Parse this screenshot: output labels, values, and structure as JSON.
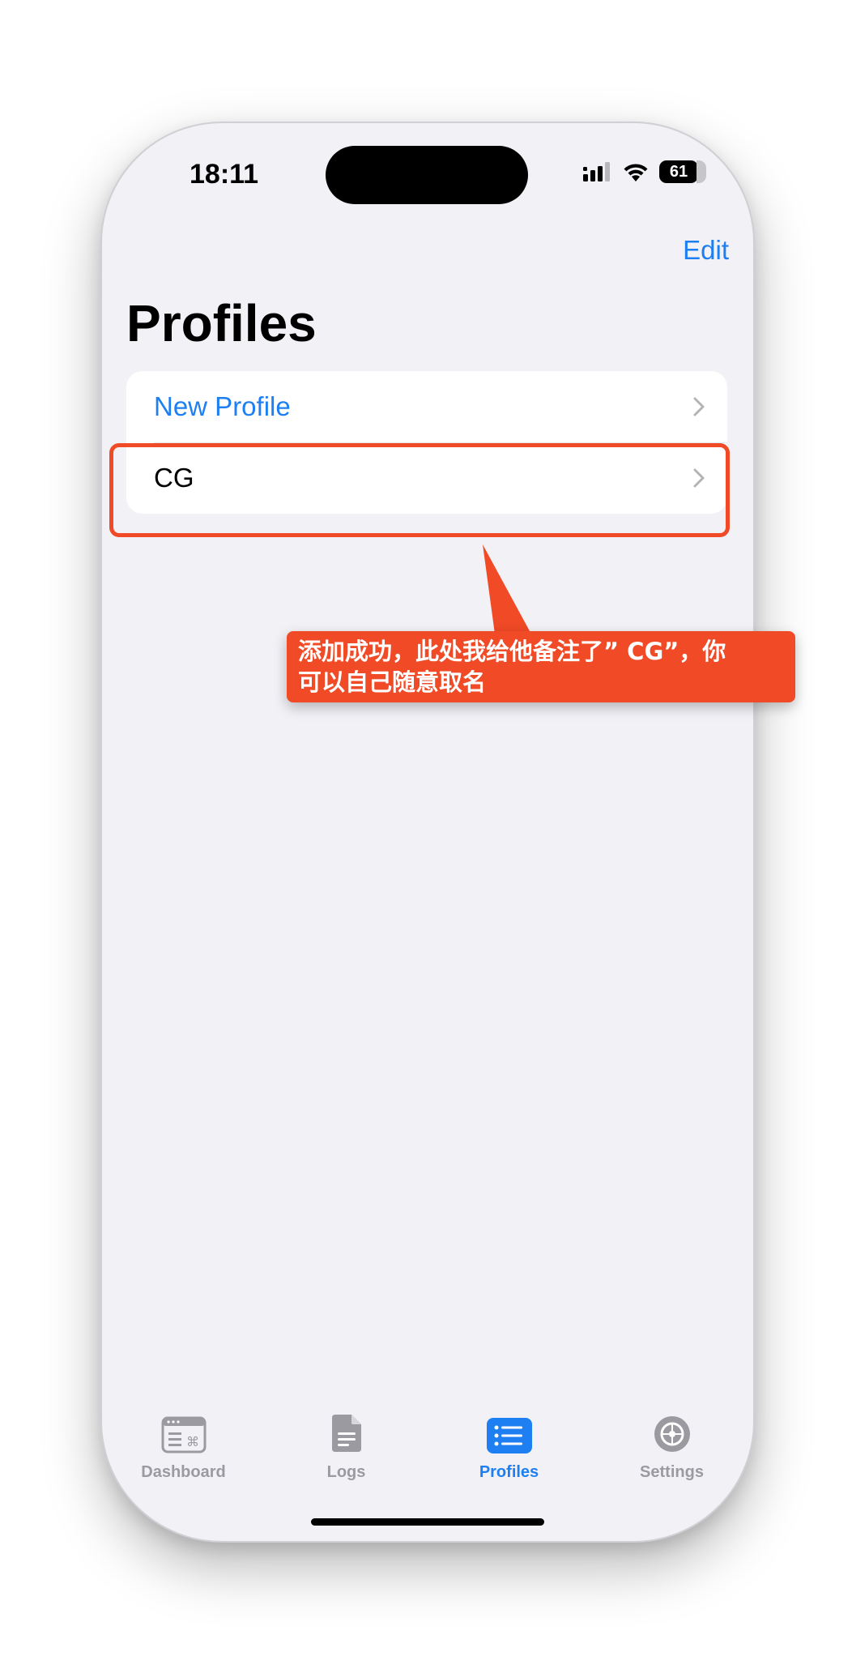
{
  "status_bar": {
    "time": "18:11",
    "battery": "61"
  },
  "nav": {
    "edit_label": "Edit",
    "title": "Profiles"
  },
  "profiles": {
    "items": [
      {
        "label": "New Profile",
        "style": "action"
      },
      {
        "label": "CG",
        "style": "default"
      }
    ]
  },
  "annotation": {
    "text_line1": "添加成功，此处我给他备注了” CG”，你",
    "text_line2": "可以自己随意取名",
    "color": "#f04a26"
  },
  "tabbar": {
    "tabs": [
      {
        "label": "Dashboard",
        "icon": "dashboard-icon",
        "active": false
      },
      {
        "label": "Logs",
        "icon": "document-icon",
        "active": false
      },
      {
        "label": "Profiles",
        "icon": "list-icon",
        "active": true
      },
      {
        "label": "Settings",
        "icon": "gear-icon",
        "active": false
      }
    ]
  },
  "colors": {
    "accent": "#1d7ff2",
    "background": "#f1f1f6",
    "inactive": "#9a9aa0"
  }
}
